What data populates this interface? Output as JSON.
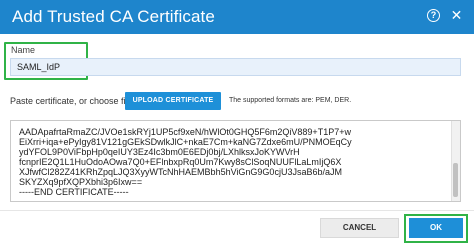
{
  "dialog": {
    "title": "Add Trusted CA Certificate",
    "help_glyph": "?",
    "close_glyph": "✕"
  },
  "name_field": {
    "label": "Name",
    "value": "SAML_IdP"
  },
  "certificate": {
    "paste_label": "Paste certificate, or choose file:",
    "upload_button": "UPLOAD CERTIFICATE",
    "formats_note": "The supported formats are: PEM, DER.",
    "lines": [
      "AADApafrtaRmaZC/JVOe1skRYj1UP5cf9xeN/hWlOt0GHQ5F6m2QiV889+T1P7+w",
      "EiXrri+iqa+ePyIgy81V121gGEkSDwlkJlC+nkaE7Cm+kaNG7Zdxe6mU/PNMOEqCy",
      "ydYFOL9P0ViFbpHp0qeIUY3Ez4Ic3bm0E6EDj0bj/LXhlksxJoKYWVrH",
      "fcnprIE2Q1L1HuOdoAOwa7Q0+EFlnbxpRq0Um7Kwy8sClSoqNUUFlLaLmIjQ6X",
      "XJfwfCl282Z41KRhZpqLJQ3XyyWTcNhHAEMBbh5hViGnG9G0cjU3JsaB6b/aJM",
      "SKYZXq9pfXQPXbhi3p6Ixw==",
      "-----END CERTIFICATE-----"
    ]
  },
  "footer": {
    "cancel": "CANCEL",
    "ok": "OK"
  },
  "colors": {
    "header": "#1e85cc",
    "primary_button": "#1e8fd8",
    "highlight_outline": "#30b347"
  }
}
